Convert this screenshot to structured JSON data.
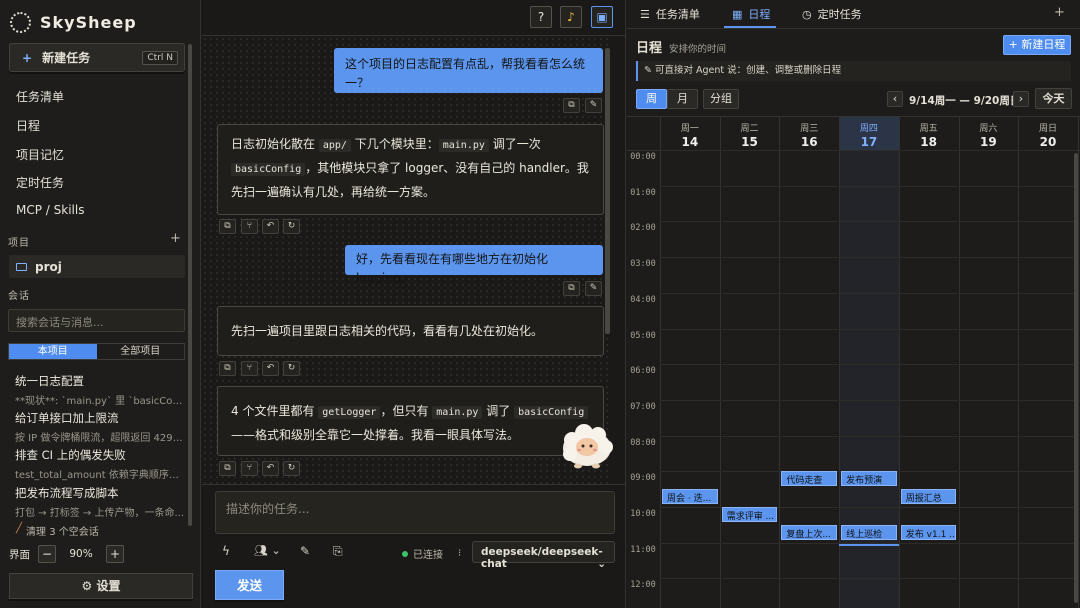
{
  "app": {
    "name": "SkySheep"
  },
  "sidebar": {
    "new_task": "新建任务",
    "new_task_shortcut": "Ctrl N",
    "nav": [
      "任务清单",
      "日程",
      "项目记忆",
      "定时任务",
      "MCP / Skills"
    ],
    "projects_header": "项目",
    "project": "proj",
    "sessions_header": "会话",
    "search_placeholder": "搜索会话与消息...",
    "scope_tabs": [
      "本项目",
      "全部项目"
    ],
    "conversations": [
      {
        "title": "统一日志配置",
        "snippet": "**现状**: `main.py` 里 `basicConfig`..."
      },
      {
        "title": "给订单接口加上限流",
        "snippet": "按 IP 做令牌桶限流，超限返回 429，..."
      },
      {
        "title": "排查 CI 上的偶发失败",
        "snippet": "test_total_amount 依赖字典顺序，改..."
      },
      {
        "title": "把发布流程写成脚本",
        "snippet": "打包 → 打标签 → 上传产物，一条命..."
      }
    ],
    "cleanup": "清理 3 个空会话",
    "zoom_label": "界面",
    "zoom_value": "90%",
    "settings": "⚙ 设置"
  },
  "chat": {
    "messages": [
      {
        "role": "user",
        "text": "这个项目的日志配置有点乱，帮我看看怎么统一？"
      },
      {
        "role": "assistant",
        "parts": [
          "日志初始化散在 ",
          "app/",
          " 下几个模块里：",
          "main.py",
          " 调了一次 ",
          "basicConfig",
          "，其他模块只拿了 logger、没有自己的 handler。我先扫一遍确认有几处，再给统一方案。"
        ]
      },
      {
        "role": "user",
        "text": "好，先看看现在有哪些地方在初始化 logging。"
      },
      {
        "role": "assistant",
        "text": "先扫一遍项目里跟日志相关的代码，看看有几处在初始化。"
      },
      {
        "role": "assistant",
        "parts": [
          "4 个文件里都有 ",
          "getLogger",
          "，但只有 ",
          "main.py",
          " 调了 ",
          "basicConfig",
          " ——格式和级别全靠它一处撑着。我看一眼具体写法。"
        ]
      }
    ],
    "input_placeholder": "描述你的任务...",
    "status": "已连接",
    "model": "deepseek/deepseek-chat",
    "send": "发送"
  },
  "panel": {
    "tabs": [
      "任务清单",
      "日程",
      "定时任务"
    ],
    "title": "日程",
    "subtitle": "安排你的时间",
    "new_event": "+ 新建日程",
    "hint": "✎ 可直接对 Agent 说：创建、调整或删除日程",
    "views": [
      "周",
      "月",
      "分组"
    ],
    "range": "9/14周一 — 9/20周日",
    "today": "今天",
    "days": [
      {
        "w": "周一",
        "d": "14"
      },
      {
        "w": "周二",
        "d": "15"
      },
      {
        "w": "周三",
        "d": "16"
      },
      {
        "w": "周四",
        "d": "17"
      },
      {
        "w": "周五",
        "d": "18"
      },
      {
        "w": "周六",
        "d": "19"
      },
      {
        "w": "周日",
        "d": "20"
      }
    ],
    "hours": [
      "00:00",
      "01:00",
      "02:00",
      "03:00",
      "04:00",
      "05:00",
      "06:00",
      "07:00",
      "08:00",
      "09:00",
      "10:00",
      "11:00",
      "12:00"
    ],
    "events": [
      {
        "day": 0,
        "start": 9.5,
        "label": "周会 · 迭..."
      },
      {
        "day": 1,
        "start": 10.0,
        "label": "需求评审 ..."
      },
      {
        "day": 2,
        "start": 9.0,
        "label": "代码走查"
      },
      {
        "day": 2,
        "start": 10.5,
        "label": "复盘上次..."
      },
      {
        "day": 3,
        "start": 9.0,
        "label": "发布预演"
      },
      {
        "day": 3,
        "start": 10.5,
        "label": "线上巡检"
      },
      {
        "day": 4,
        "start": 9.5,
        "label": "周报汇总"
      },
      {
        "day": 4,
        "start": 10.5,
        "label": "发布 v1.1 ..."
      }
    ]
  },
  "colors": {
    "accent": "#5b95ee",
    "bg": "#1c1b19"
  }
}
